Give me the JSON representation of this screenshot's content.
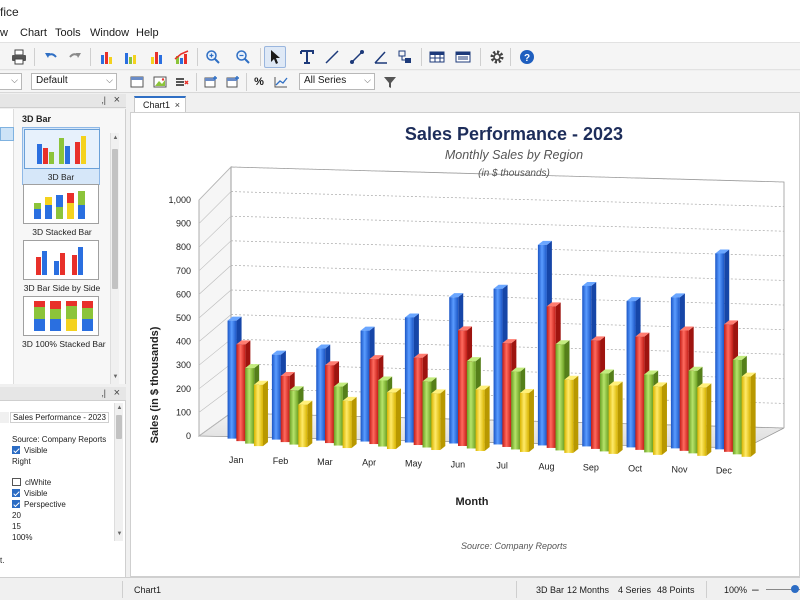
{
  "window": {
    "title_fragment": "fice"
  },
  "menu": [
    "w",
    "Chart",
    "Tools",
    "Window",
    "Help"
  ],
  "toolbar": {
    "icons": [
      "print-icon",
      "undo-icon",
      "redo-icon",
      "bar-chart-icon",
      "column-chart-icon",
      "stacked-bar-icon",
      "area-line-chart-icon",
      "zoom-in-icon",
      "zoom-out-icon",
      "pointer-icon",
      "text-tool-icon",
      "line-tool-icon",
      "connector-tool-icon",
      "angle-tool-icon",
      "shapes-tool-icon",
      "data-table-icon",
      "data-view-icon",
      "settings-icon",
      "help-icon"
    ]
  },
  "formatbar": {
    "style_combo": "Default",
    "series_combo": "All Series",
    "percent_label": "%"
  },
  "gallery_panel": {
    "group_label": "3D Bar",
    "items": [
      {
        "label": "3D Bar",
        "selected": true
      },
      {
        "label": "3D Stacked Bar",
        "selected": false
      },
      {
        "label": "3D Bar Side by Side",
        "selected": false
      },
      {
        "label": "3D 100% Stacked Bar",
        "selected": false
      }
    ]
  },
  "properties_panel": {
    "title_value": "Sales Performance - 2023",
    "footer_value": "Source: Company Reports",
    "visible_label": "Visible",
    "legend_pos": "Right",
    "back_color": "clWhite",
    "border_visible_label": "Visible",
    "perspective_label": "Perspective",
    "depth": "20",
    "elevation": "15",
    "zoom": "100%"
  },
  "hint_text": "t.",
  "doc_tab": {
    "label": "Chart1"
  },
  "statusbar": {
    "doc": "Chart1",
    "chart_type": "3D Bar",
    "months": "12 Months",
    "series": "4 Series",
    "points": "48 Points",
    "zoom": "100%",
    "zoom_fraction": 0.85
  },
  "colors": {
    "accent": "#2f6fc4",
    "series": [
      "#2a6fe0",
      "#e8302a",
      "#8cc43a",
      "#f4d21e"
    ],
    "title": "#1d2d5a"
  },
  "chart_data": {
    "type": "bar",
    "title": "Sales Performance - 2023",
    "subtitle": "Monthly Sales by Region",
    "unit_note": "(in $ thousands)",
    "xlabel": "Month",
    "ylabel": "Sales (in $ thousands)",
    "footer": "Source: Company Reports",
    "ylim": [
      0,
      1000
    ],
    "yticks": [
      "0",
      "100",
      "200",
      "300",
      "400",
      "500",
      "600",
      "700",
      "800",
      "900",
      "1,000"
    ],
    "categories": [
      "Jan",
      "Feb",
      "Mar",
      "Apr",
      "May",
      "Jun",
      "Jul",
      "Aug",
      "Sep",
      "Oct",
      "Nov",
      "Dec"
    ],
    "grid": true,
    "legend": "none",
    "series": [
      {
        "values": [
          500,
          360,
          390,
          470,
          530,
          620,
          660,
          850,
          680,
          620,
          640,
          830
        ]
      },
      {
        "values": [
          410,
          280,
          330,
          360,
          370,
          490,
          440,
          600,
          460,
          480,
          510,
          540
        ]
      },
      {
        "values": [
          320,
          230,
          250,
          280,
          280,
          370,
          330,
          450,
          330,
          330,
          350,
          400
        ]
      },
      {
        "values": [
          260,
          180,
          200,
          240,
          240,
          260,
          250,
          310,
          290,
          290,
          290,
          340
        ]
      }
    ]
  }
}
